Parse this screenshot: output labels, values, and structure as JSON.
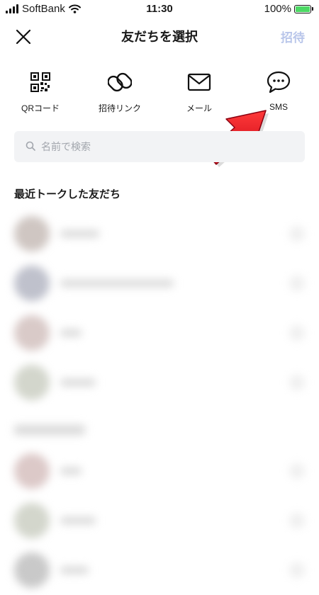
{
  "status_bar": {
    "carrier": "SoftBank",
    "time": "11:30",
    "battery": "100%",
    "battery_level": 1.0
  },
  "header": {
    "title": "友だちを選択",
    "invite_label": "招待",
    "close_icon": "close-icon"
  },
  "share_options": [
    {
      "label": "QRコード",
      "icon": "qr-code-icon"
    },
    {
      "label": "招待リンク",
      "icon": "link-icon"
    },
    {
      "label": "メール",
      "icon": "mail-icon"
    },
    {
      "label": "SMS",
      "icon": "chat-bubble-icon"
    }
  ],
  "search": {
    "placeholder": "名前で検索",
    "value": ""
  },
  "recent": {
    "heading": "最近トークした友だち"
  },
  "colors": {
    "invite_disabled": "#b9c6ea",
    "arrow": "#e60012",
    "accent_green": "#4cd964"
  }
}
